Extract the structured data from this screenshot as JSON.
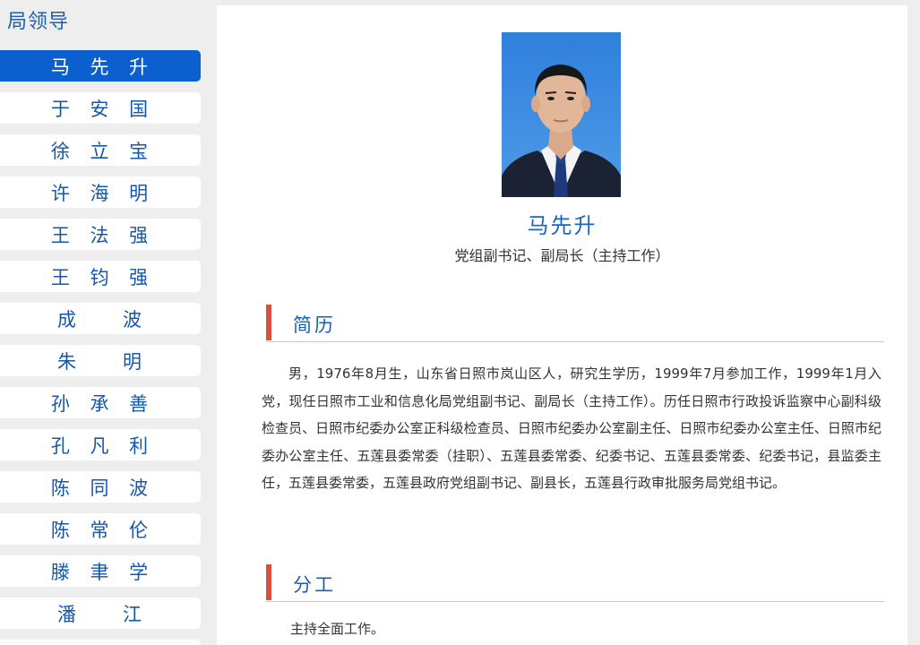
{
  "sidebar": {
    "title": "局领导",
    "items": [
      {
        "label": "马 先 升",
        "active": true
      },
      {
        "label": "于 安 国",
        "active": false
      },
      {
        "label": "徐 立 宝",
        "active": false
      },
      {
        "label": "许 海 明",
        "active": false
      },
      {
        "label": "王 法 强",
        "active": false
      },
      {
        "label": "王 钧 强",
        "active": false
      },
      {
        "label": "成   波",
        "active": false
      },
      {
        "label": "朱   明",
        "active": false
      },
      {
        "label": "孙 承 善",
        "active": false
      },
      {
        "label": "孔 凡 利",
        "active": false
      },
      {
        "label": "陈 同 波",
        "active": false
      },
      {
        "label": "陈 常 伦",
        "active": false
      },
      {
        "label": "滕 聿 学",
        "active": false
      },
      {
        "label": "潘   江",
        "active": false
      }
    ]
  },
  "profile": {
    "name": "马先升",
    "title": "党组副书记、副局长（主持工作）",
    "photo_icon": "portrait-photo"
  },
  "sections": {
    "bio_heading": "简历",
    "bio_text": "男，1976年8月生，山东省日照市岚山区人，研究生学历，1999年7月参加工作，1999年1月入党，现任日照市工业和信息化局党组副书记、副局长（主持工作）。历任日照市行政投诉监察中心副科级检查员、日照市纪委办公室正科级检查员、日照市纪委办公室副主任、日照市纪委办公室主任、日照市纪委办公室主任、五莲县委常委（挂职）、五莲县委常委、纪委书记、五莲县委常委、纪委书记，县监委主任，五莲县委常委，五莲县政府党组副书记、副县长，五莲县行政审批服务局党组书记。",
    "duty_heading": "分工",
    "duty_text": "主持全面工作。"
  },
  "colors": {
    "accent": "#0b5fcf",
    "link": "#1557a8",
    "section_bar": "#d9503f"
  }
}
